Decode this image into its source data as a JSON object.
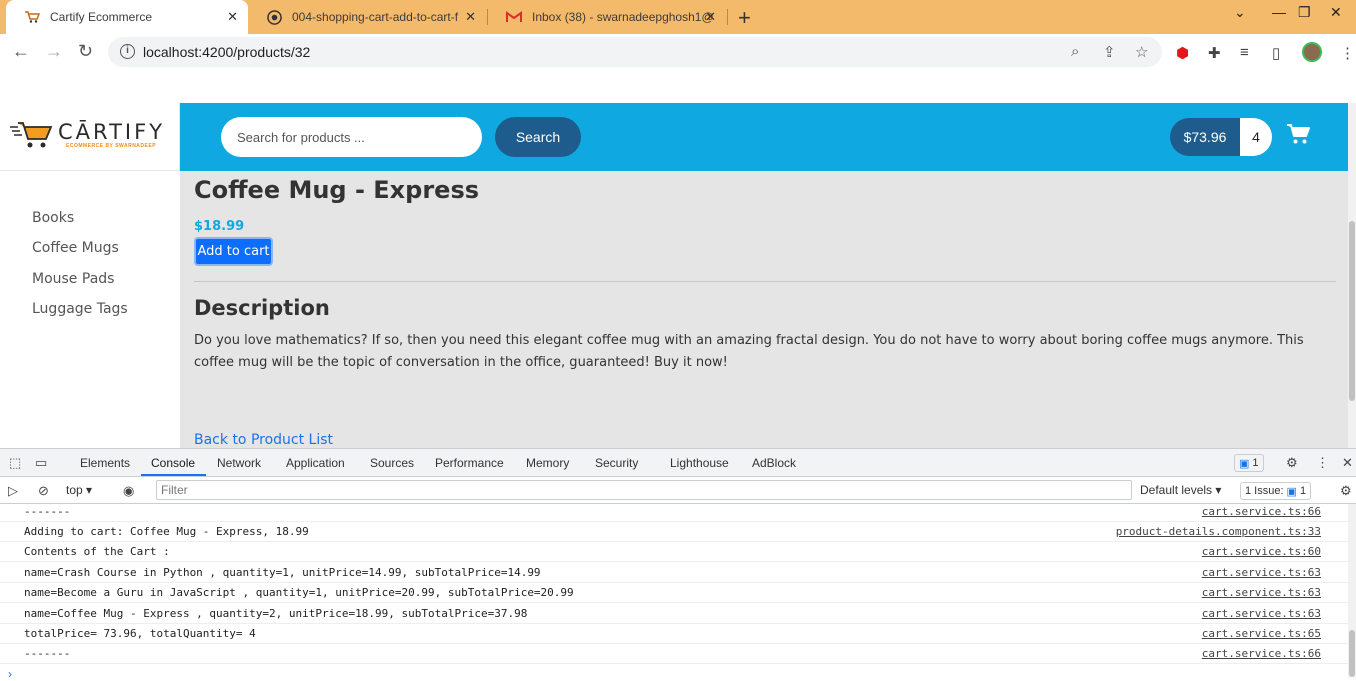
{
  "browser": {
    "tabs": [
      {
        "title": "Cartify Ecommerce",
        "icon": "cart-favicon"
      },
      {
        "title": "004-shopping-cart-add-to-cart-f",
        "icon": "github-favicon"
      },
      {
        "title": "Inbox (38) - swarnadeepghosh1@",
        "icon": "gmail-favicon"
      }
    ],
    "new_tab": "+",
    "url": "localhost:4200/products/32"
  },
  "store": {
    "logo_text": "CĀRTIFY",
    "logo_tagline": "ECOMMERCE BY SWARNADEEP",
    "search_placeholder": "Search for products ...",
    "search_button": "Search",
    "cart_total": "$73.96",
    "cart_quantity": "4",
    "accent_color": "#10a8e0",
    "dark_blue": "#1e5c8e"
  },
  "sidebar": {
    "items": [
      {
        "label": "Books"
      },
      {
        "label": "Coffee Mugs"
      },
      {
        "label": "Mouse Pads"
      },
      {
        "label": "Luggage Tags"
      }
    ]
  },
  "product": {
    "title": "Coffee Mug - Express",
    "price": "$18.99",
    "add_button": "Add to cart",
    "description_heading": "Description",
    "description": "Do you love mathematics? If so, then you need this elegant coffee mug with an amazing fractal design. You do not have to worry about boring coffee mugs anymore. This coffee mug will be the topic of conversation in the office, guaranteed! Buy it now!",
    "back_link": "Back to Product List"
  },
  "devtools": {
    "tabs": [
      "Elements",
      "Console",
      "Network",
      "Application",
      "Sources",
      "Performance",
      "Memory",
      "Security",
      "Lighthouse",
      "AdBlock"
    ],
    "active_tab": "Console",
    "messages_badge": "1",
    "context": "top",
    "filter_placeholder": "Filter",
    "levels": "Default levels",
    "issues": "1 Issue:",
    "issues_count": "1",
    "logs": [
      {
        "msg": "-------",
        "src": "cart.service.ts:66"
      },
      {
        "msg": "Adding to cart: Coffee Mug - Express, 18.99",
        "src": "product-details.component.ts:33"
      },
      {
        "msg": "Contents of the Cart :",
        "src": "cart.service.ts:60"
      },
      {
        "msg": "name=Crash Course in Python , quantity=1, unitPrice=14.99, subTotalPrice=14.99",
        "src": "cart.service.ts:63"
      },
      {
        "msg": "name=Become a Guru in JavaScript , quantity=1, unitPrice=20.99, subTotalPrice=20.99",
        "src": "cart.service.ts:63"
      },
      {
        "msg": "name=Coffee Mug - Express , quantity=2, unitPrice=18.99, subTotalPrice=37.98",
        "src": "cart.service.ts:63"
      },
      {
        "msg": "totalPrice= 73.96, totalQuantity= 4",
        "src": "cart.service.ts:65"
      },
      {
        "msg": "-------",
        "src": "cart.service.ts:66"
      }
    ],
    "prompt": "›"
  }
}
